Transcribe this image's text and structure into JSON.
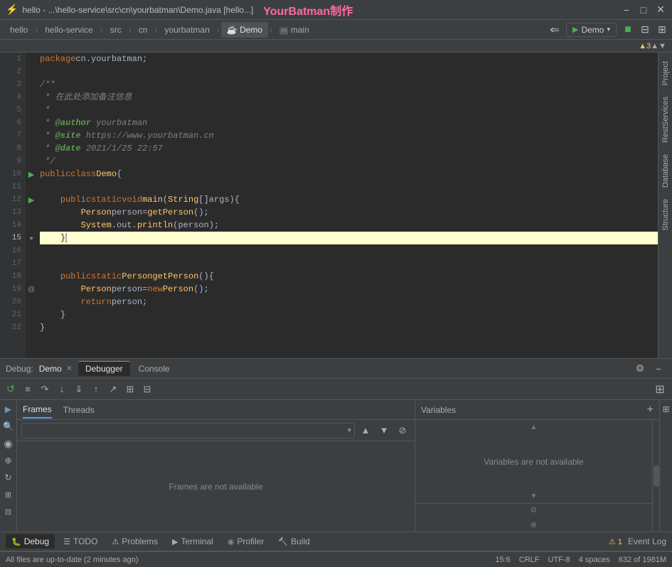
{
  "titlebar": {
    "title": "hello - ...\\hello-service\\src\\cn\\yourbatman\\Demo.java [hello...]",
    "watermark": "YourBatman制作",
    "minimize": "−",
    "maximize": "□",
    "close": "✕"
  },
  "breadcrumb": {
    "items": [
      "hello",
      "hello-service",
      "src",
      "cn",
      "yourbatman",
      "Demo",
      "main"
    ],
    "file_icon": "☕",
    "method_icon": "m"
  },
  "code": {
    "lines": [
      {
        "num": 1,
        "content": "package cn.yourbatman;"
      },
      {
        "num": 2,
        "content": ""
      },
      {
        "num": 3,
        "content": "/**"
      },
      {
        "num": 4,
        "content": " * 在此处添加备注信息"
      },
      {
        "num": 5,
        "content": " *"
      },
      {
        "num": 6,
        "content": " * @author yourbatman"
      },
      {
        "num": 7,
        "content": " * @site https://www.yourbatman.cn"
      },
      {
        "num": 8,
        "content": " * @date 2021/1/25 22:57"
      },
      {
        "num": 9,
        "content": " */"
      },
      {
        "num": 10,
        "content": "public class Demo {"
      },
      {
        "num": 11,
        "content": ""
      },
      {
        "num": 12,
        "content": "    public static void main(String[] args) {"
      },
      {
        "num": 13,
        "content": "        Person person = getPerson();"
      },
      {
        "num": 14,
        "content": "        System.out.println(person);"
      },
      {
        "num": 15,
        "content": "    }",
        "highlighted": true
      },
      {
        "num": 16,
        "content": ""
      },
      {
        "num": 17,
        "content": ""
      },
      {
        "num": 18,
        "content": "    public static Person getPerson() {"
      },
      {
        "num": 19,
        "content": "        Person person = new Person();"
      },
      {
        "num": 20,
        "content": "        return person;"
      },
      {
        "num": 21,
        "content": "    }"
      },
      {
        "num": 22,
        "content": "}"
      }
    ]
  },
  "warnings": {
    "count": 3,
    "label": "▲ 3"
  },
  "right_tabs": [
    "Project",
    "RestServices",
    "Database",
    "Structure"
  ],
  "debug": {
    "session_label": "Debug:",
    "session_name": "Demo",
    "tabs": [
      "Debugger",
      "Console"
    ],
    "active_tab": "Debugger",
    "toolbar_buttons": [
      "≡",
      "↑",
      "↓",
      "↘",
      "↗",
      "⊞",
      "⊟"
    ],
    "frames_tabs": [
      "Frames",
      "Threads"
    ],
    "active_frames_tab": "Frames",
    "frames_empty": "Frames are not available",
    "variables_label": "Variables",
    "variables_empty": "Variables are not available"
  },
  "bottom_tabs": [
    {
      "icon": "🐛",
      "label": "Debug",
      "active": true
    },
    {
      "icon": "☰",
      "label": "TODO"
    },
    {
      "icon": "⚠",
      "label": "Problems"
    },
    {
      "icon": "▶",
      "label": "Terminal"
    },
    {
      "icon": "📊",
      "label": "Profiler"
    },
    {
      "icon": "🔨",
      "label": "Build"
    }
  ],
  "statusbar": {
    "message": "All files are up-to-date (2 minutes ago)",
    "position": "15:6",
    "line_ending": "CRLF",
    "encoding": "UTF-8",
    "indent": "4 spaces",
    "memory": "632 of 1981M",
    "event_log": "Event Log",
    "event_count": "1"
  }
}
